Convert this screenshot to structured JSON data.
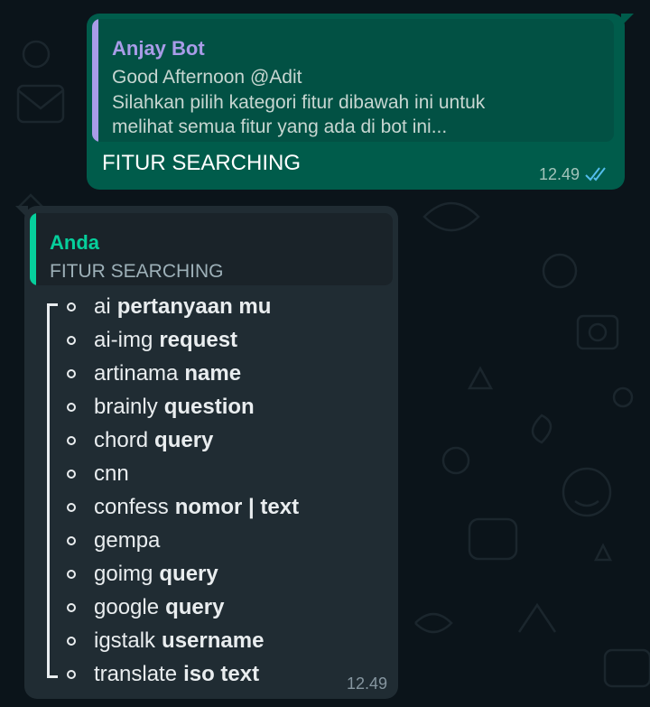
{
  "colors": {
    "background": "#0b141a",
    "outgoing_bubble": "#005c4b",
    "incoming_bubble": "#202c33",
    "quote_bar_bot": "#a99ce8",
    "quote_bar_you": "#06cf9c",
    "read_ticks": "#53bdeb"
  },
  "outgoing": {
    "quote": {
      "author": "Anjay Bot",
      "lines": [
        "Good Afternoon @Adit",
        "Silahkan pilih kategori fitur dibawah ini untuk",
        "melihat semua fitur yang ada di bot ini..."
      ]
    },
    "text": "FITUR SEARCHING",
    "time": "12.49",
    "status_icon": "double-check-icon"
  },
  "incoming": {
    "quote": {
      "author": "Anda",
      "text": "FITUR SEARCHING"
    },
    "items": [
      {
        "cmd": "ai",
        "arg": "pertanyaan mu"
      },
      {
        "cmd": "ai-img",
        "arg": "request"
      },
      {
        "cmd": "artinama",
        "arg": "name"
      },
      {
        "cmd": "brainly",
        "arg": "question"
      },
      {
        "cmd": "chord",
        "arg": "query"
      },
      {
        "cmd": "cnn",
        "arg": ""
      },
      {
        "cmd": "confess",
        "arg": "nomor | text"
      },
      {
        "cmd": "gempa",
        "arg": ""
      },
      {
        "cmd": "goimg",
        "arg": "query"
      },
      {
        "cmd": "google",
        "arg": "query"
      },
      {
        "cmd": "igstalk",
        "arg": "username"
      },
      {
        "cmd": "translate",
        "arg": "iso text"
      }
    ],
    "time": "12.49"
  }
}
